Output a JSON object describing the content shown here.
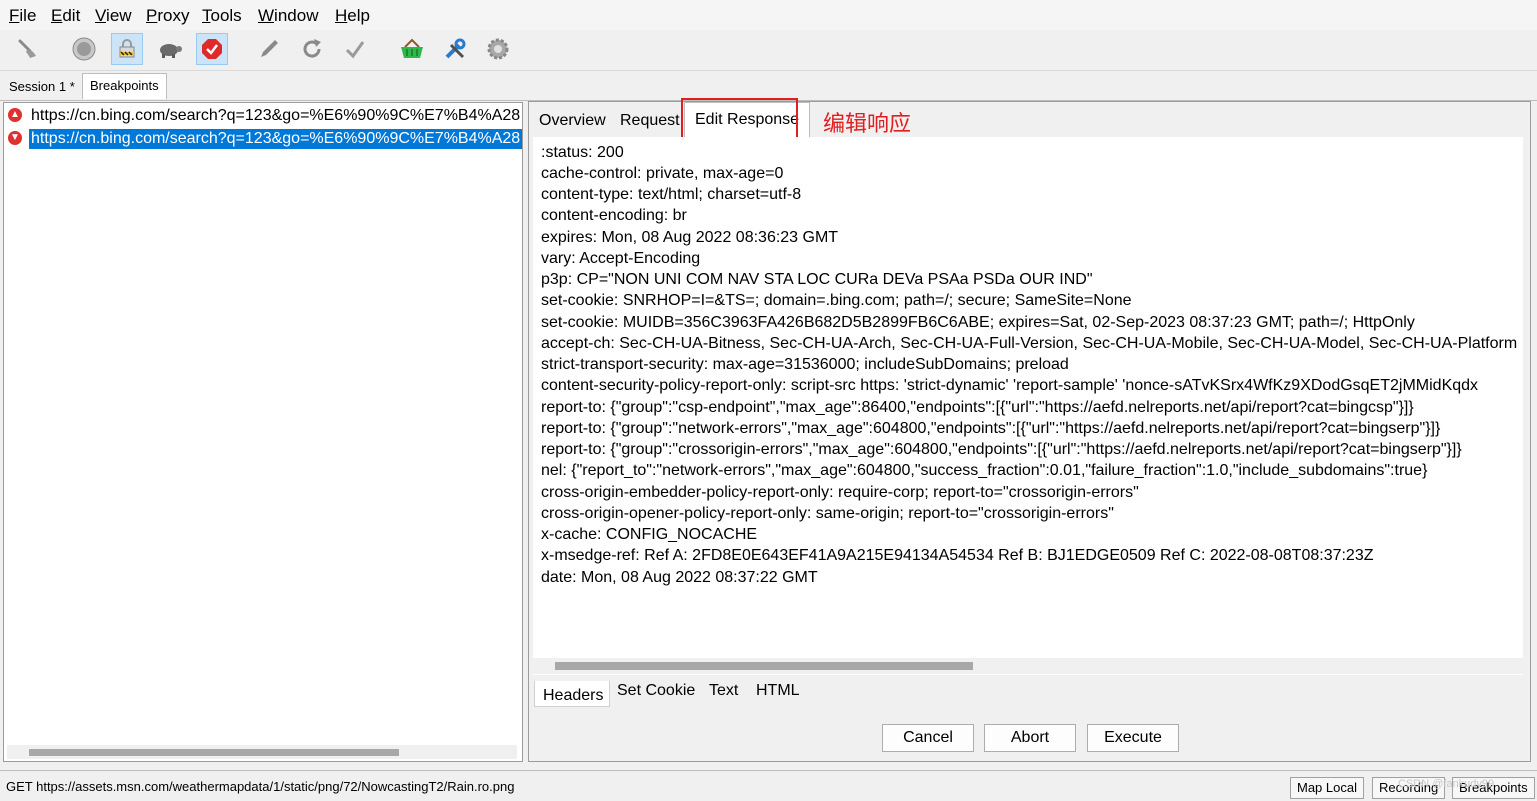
{
  "menu": {
    "items": [
      {
        "acc": "F",
        "rest": "ile"
      },
      {
        "acc": "E",
        "rest": "dit"
      },
      {
        "acc": "V",
        "rest": "iew"
      },
      {
        "acc": "P",
        "rest": "roxy"
      },
      {
        "acc": "T",
        "rest": "ools"
      },
      {
        "acc": "W",
        "rest": "indow"
      },
      {
        "acc": "H",
        "rest": "elp"
      }
    ]
  },
  "toolbar": {
    "buttons": [
      "clear-icon",
      "record-icon",
      "breakpoint-lock-icon",
      "throttle-icon",
      "breakpoints-icon",
      "compose-icon",
      "repeat-icon",
      "validate-icon",
      "basket-icon",
      "tools-icon",
      "settings-icon"
    ]
  },
  "session_tabs": [
    "Session 1 *",
    "Breakpoints"
  ],
  "breakpoints": {
    "items": [
      {
        "url": "https://cn.bing.com/search?q=123&go=%E6%90%9C%E7%B4%A28",
        "direction": "request"
      },
      {
        "url": "https://cn.bing.com/search?q=123&go=%E6%90%9C%E7%B4%A28",
        "direction": "response"
      }
    ]
  },
  "detail": {
    "tabs": [
      "Overview",
      "Request",
      "Edit Response"
    ],
    "annotation": "编辑响应",
    "headers": [
      ":status: 200",
      "cache-control: private, max-age=0",
      "content-type: text/html; charset=utf-8",
      "content-encoding: br",
      "expires: Mon, 08 Aug 2022 08:36:23 GMT",
      "vary: Accept-Encoding",
      "p3p: CP=\"NON UNI COM NAV STA LOC CURa DEVa PSAa PSDa OUR IND\"",
      "set-cookie: SNRHOP=I=&TS=; domain=.bing.com; path=/; secure; SameSite=None",
      "set-cookie: MUIDB=356C3963FA426B682D5B2899FB6C6ABE; expires=Sat, 02-Sep-2023 08:37:23 GMT; path=/; HttpOnly",
      "accept-ch: Sec-CH-UA-Bitness, Sec-CH-UA-Arch, Sec-CH-UA-Full-Version, Sec-CH-UA-Mobile, Sec-CH-UA-Model, Sec-CH-UA-Platform",
      "strict-transport-security: max-age=31536000; includeSubDomains; preload",
      "content-security-policy-report-only: script-src https: 'strict-dynamic' 'report-sample' 'nonce-sATvKSrx4WfKz9XDodGsqET2jMMidKqdx",
      "report-to: {\"group\":\"csp-endpoint\",\"max_age\":86400,\"endpoints\":[{\"url\":\"https://aefd.nelreports.net/api/report?cat=bingcsp\"}]}",
      "report-to: {\"group\":\"network-errors\",\"max_age\":604800,\"endpoints\":[{\"url\":\"https://aefd.nelreports.net/api/report?cat=bingserp\"}]}",
      "report-to: {\"group\":\"crossorigin-errors\",\"max_age\":604800,\"endpoints\":[{\"url\":\"https://aefd.nelreports.net/api/report?cat=bingserp\"}]}",
      "nel: {\"report_to\":\"network-errors\",\"max_age\":604800,\"success_fraction\":0.01,\"failure_fraction\":1.0,\"include_subdomains\":true}",
      "cross-origin-embedder-policy-report-only: require-corp; report-to=\"crossorigin-errors\"",
      "cross-origin-opener-policy-report-only: same-origin; report-to=\"crossorigin-errors\"",
      "x-cache: CONFIG_NOCACHE",
      "x-msedge-ref: Ref A: 2FD8E0E643EF41A9A215E94134A54534 Ref B: BJ1EDGE0509 Ref C: 2022-08-08T08:37:23Z",
      "date: Mon, 08 Aug 2022 08:37:22 GMT"
    ],
    "bottom_tabs": [
      "Headers",
      "Set Cookie",
      "Text",
      "HTML"
    ],
    "buttons": {
      "cancel": "Cancel",
      "abort": "Abort",
      "execute": "Execute"
    }
  },
  "status": {
    "text": "GET https://assets.msn.com/weathermapdata/1/static/png/72/NowcastingT2/Rain.ro.png",
    "buttons": [
      "Map Local",
      "Recording",
      "Breakpoints"
    ],
    "watermark": "CSDN @fankudy99"
  },
  "colors": {
    "accent": "#0078d7",
    "annotation": "#e02020"
  }
}
